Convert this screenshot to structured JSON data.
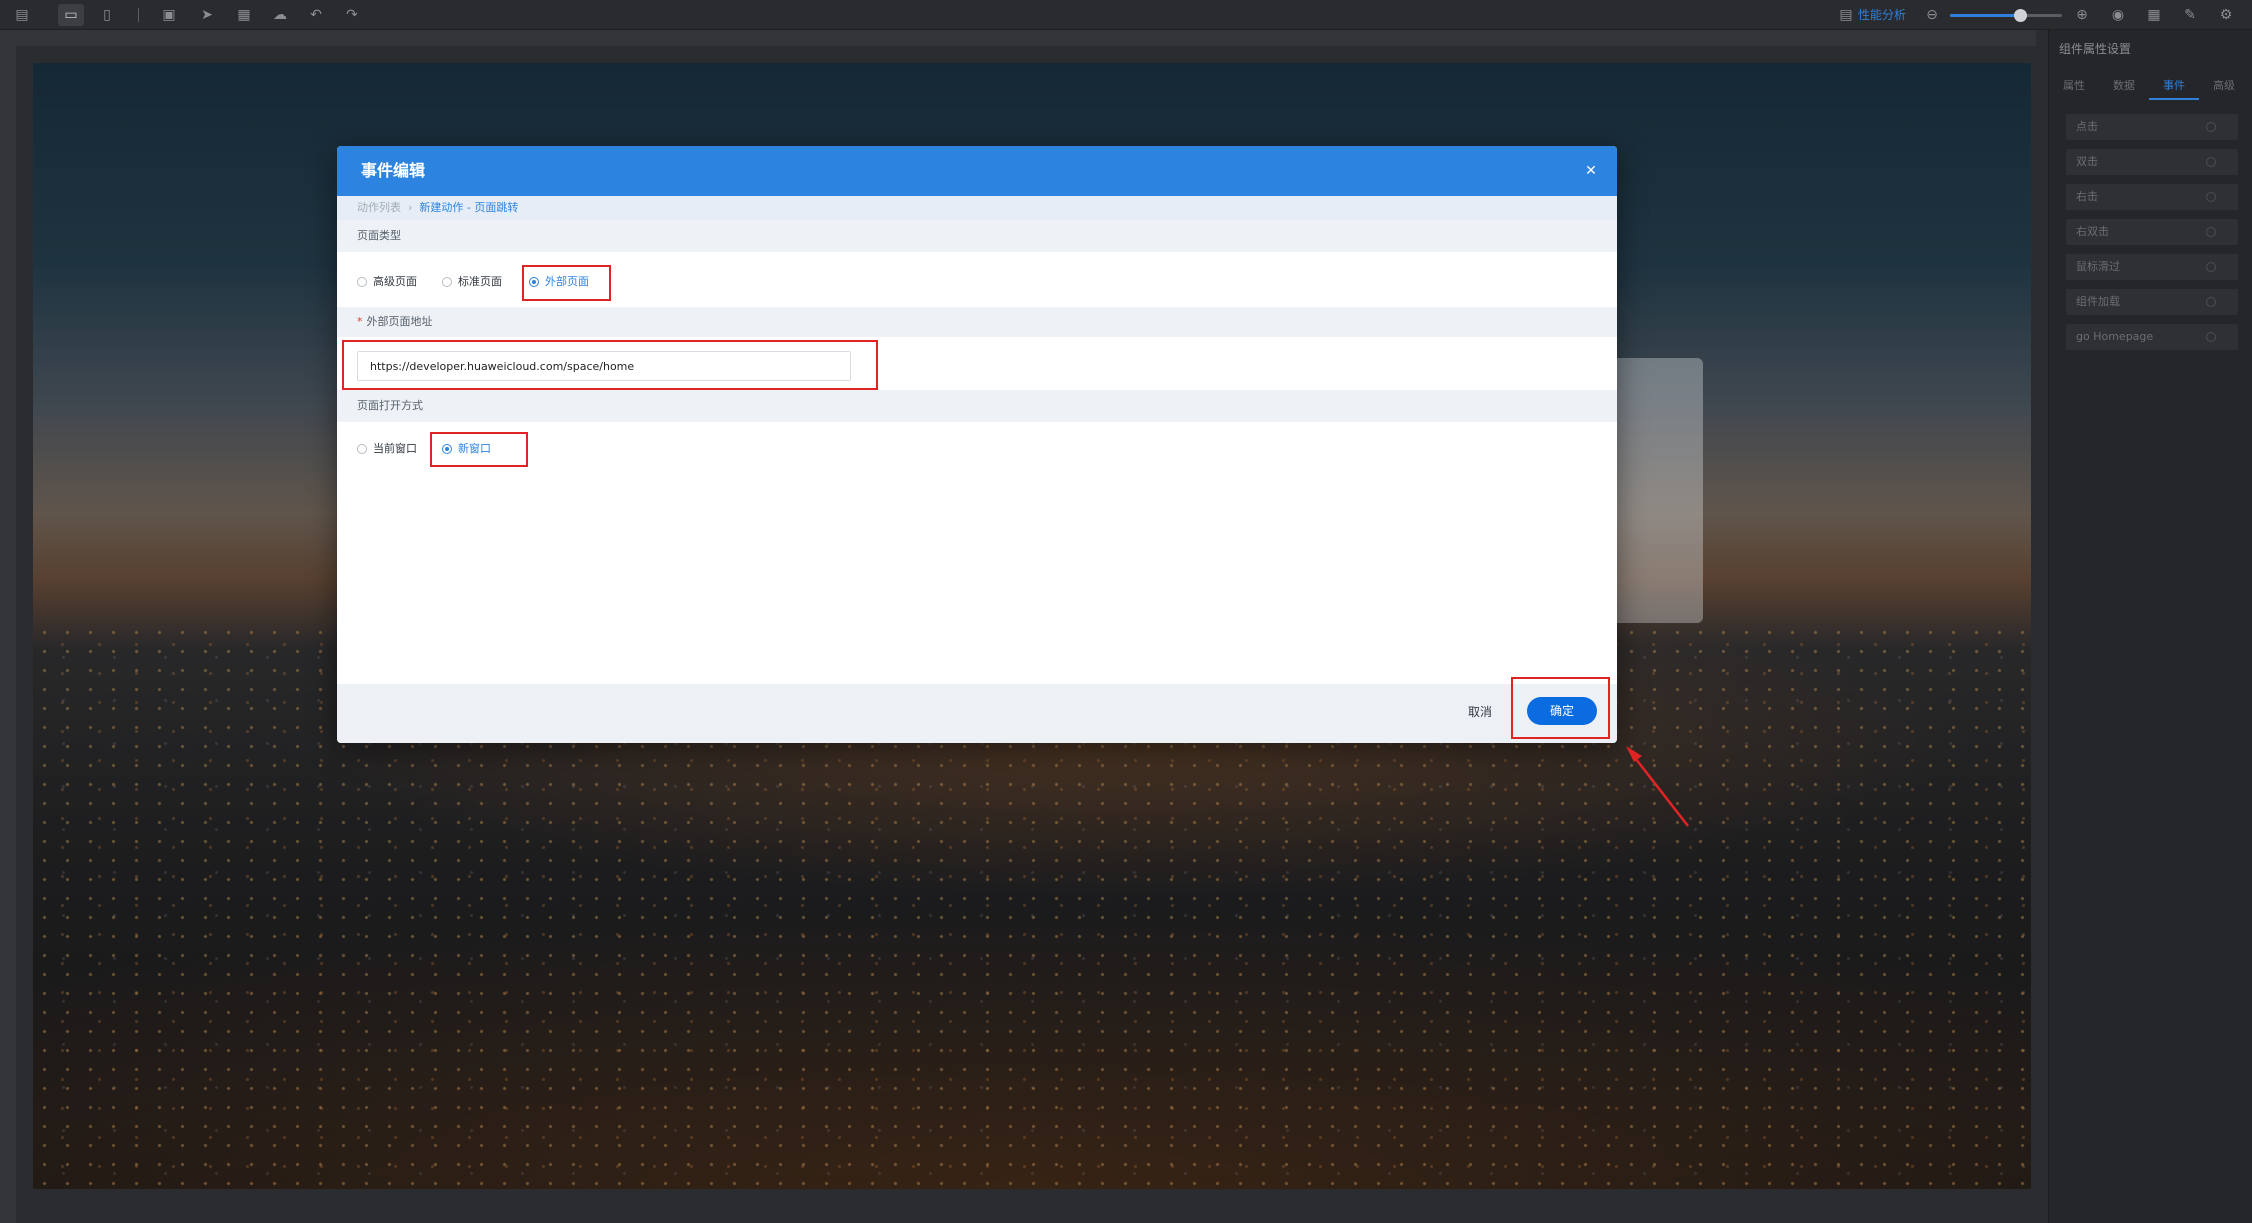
{
  "toolbar": {
    "icons": [
      "layout-icon",
      "desktop-icon",
      "mobile-icon",
      "save-icon",
      "send-icon",
      "preview-icon",
      "cloud-icon",
      "undo-icon",
      "redo-icon"
    ],
    "perf_label": "性能分析",
    "zoom_level": 0.62
  },
  "right_panel": {
    "title": "组件属性设置",
    "tabs": [
      "属性",
      "数据",
      "事件",
      "高级"
    ],
    "active_tab": 2,
    "events": [
      "点击",
      "双击",
      "右击",
      "右双击",
      "鼠标滑过",
      "组件加载",
      "go Homepage"
    ]
  },
  "modal": {
    "title": "事件编辑",
    "breadcrumb": [
      "动作列表",
      "新建动作 - 页面跳转"
    ],
    "page_type": {
      "label": "页面类型",
      "options": [
        "高级页面",
        "标准页面",
        "外部页面"
      ],
      "selected": 2
    },
    "external_url": {
      "label": "外部页面地址",
      "required": true,
      "value": "https://developer.huaweicloud.com/space/home"
    },
    "open_mode": {
      "label": "页面打开方式",
      "options": [
        "当前窗口",
        "新窗口"
      ],
      "selected": 1
    },
    "cancel_label": "取消",
    "confirm_label": "确定"
  },
  "colors": {
    "accent": "#2d84e0",
    "primary_button": "#0b6be0",
    "highlight": "#e02424"
  }
}
